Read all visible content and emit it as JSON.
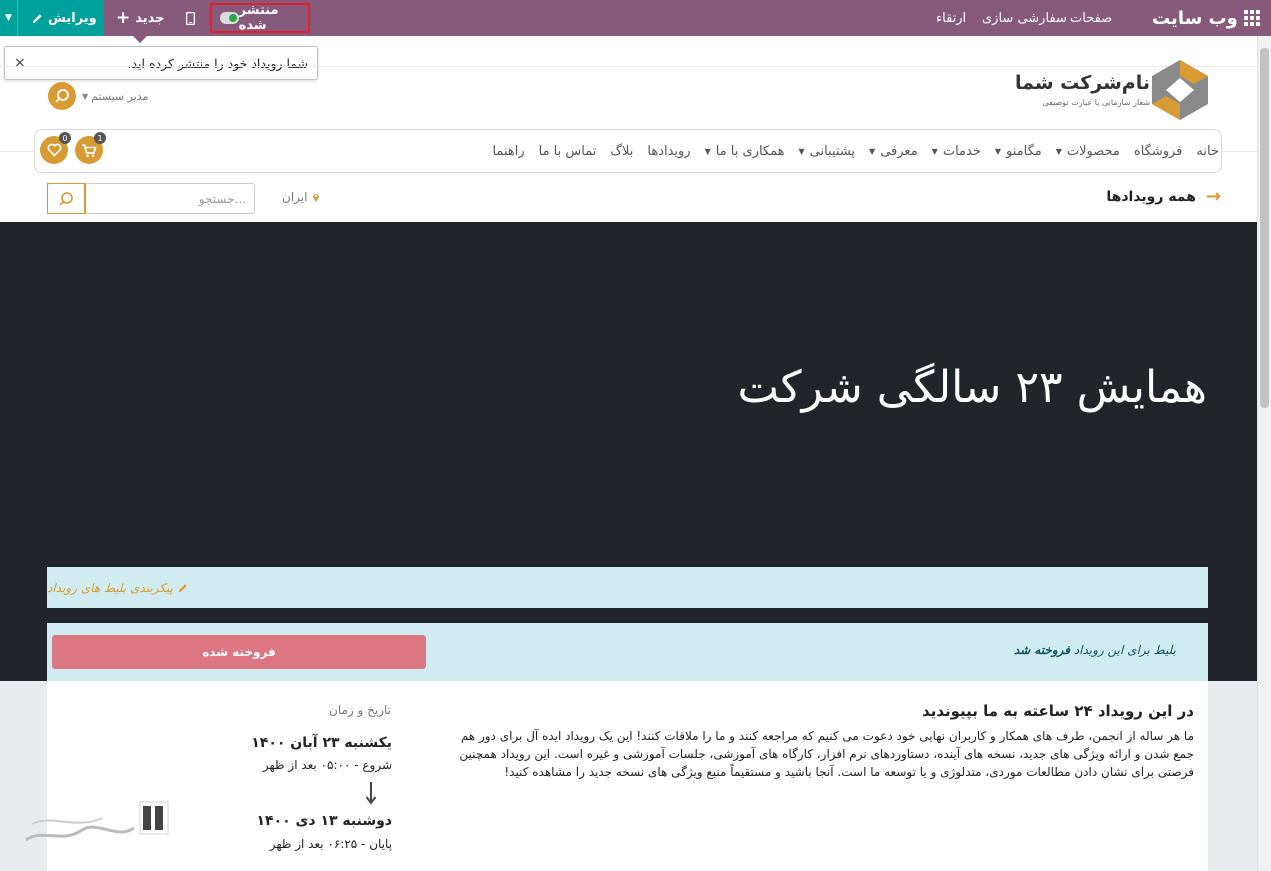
{
  "topbar": {
    "edit_label": "ویرایش",
    "new_label": "جدید",
    "publish_label": "منتشر شده",
    "upgrade_label": "ارتقاء",
    "customize_label": "سفارشی سازی",
    "pages_label": "صفحات",
    "site_label": "وب سایت",
    "bg_color": "#875a7b",
    "edit_color": "#00a09d",
    "published": true
  },
  "tooltip": {
    "text": "شما رویداد خود را منتشر کرده اید.",
    "close_label": "×"
  },
  "header": {
    "company_name": "نام‌شرکت شما",
    "company_slogan": "شعار سازمانی یا عبارت توصیفی",
    "admin_user": "مدیر سیستم",
    "cart_count": "1",
    "wishlist_count": "0",
    "accent_color": "#d89b33"
  },
  "nav": {
    "items": [
      {
        "label": "خانه",
        "dropdown": false
      },
      {
        "label": "فروشگاه",
        "dropdown": false
      },
      {
        "label": "محصولات",
        "dropdown": true
      },
      {
        "label": "مگامنو",
        "dropdown": true
      },
      {
        "label": "خدمات",
        "dropdown": true
      },
      {
        "label": "معرفی",
        "dropdown": true
      },
      {
        "label": "پشتیبانی",
        "dropdown": true
      },
      {
        "label": "همکاری با ما",
        "dropdown": true
      },
      {
        "label": "رویدادها",
        "dropdown": false
      },
      {
        "label": "بلاگ",
        "dropdown": false
      },
      {
        "label": "تماس با ما",
        "dropdown": false
      },
      {
        "label": "راهنما",
        "dropdown": false
      }
    ]
  },
  "subbar": {
    "all_events": "همه رویدادها",
    "location": "ایران",
    "search_placeholder": "جستجو..."
  },
  "event": {
    "title": "همایش ۲۳ سالگی شرکت",
    "config_tickets": "پیکربندی بلیط های رویداد",
    "sold_prefix": "بلیط برای این رویداد",
    "sold_bold": "فروخته شد",
    "sold_button": "فروخته شده",
    "intro_title": "در این رویداد ۲۴ ساعته به ما بپیوندید",
    "intro_text": "ما هر ساله از انجمن، طرف های همکار و کاربران نهایی خود دعوت می کنیم که مراجعه کنند و ما را ملاقات کنند! این یک رویداد ایده آل برای دور هم جمع شدن و ارائه ویژگی های جدید، نسخه های آینده، دستاوردهای نرم افزار، کارگاه های آموزشی، جلسات آموزشی و غیره است. این رویداد همچنین فرصتی برای نشان دادن مطالعات موردی، متدلوژی و یا توسعه ما است. آنجا باشید و مستقیماً منبع ویژگی های نسخه جدید را مشاهده کنید!",
    "date_label": "تاریخ و زمان",
    "start_date": "یکشنبه ۲۳ آبان ۱۴۰۰",
    "start_time": "شروع - ۰۵:۰۰ بعد از ظهر",
    "end_date": "دوشنبه ۱۳ دی ۱۴۰۰",
    "end_time": "پایان - ۰۶:۲۵ بعد از ظهر",
    "sold_color": "#dc7680",
    "info_bg": "#d1ecf1"
  }
}
